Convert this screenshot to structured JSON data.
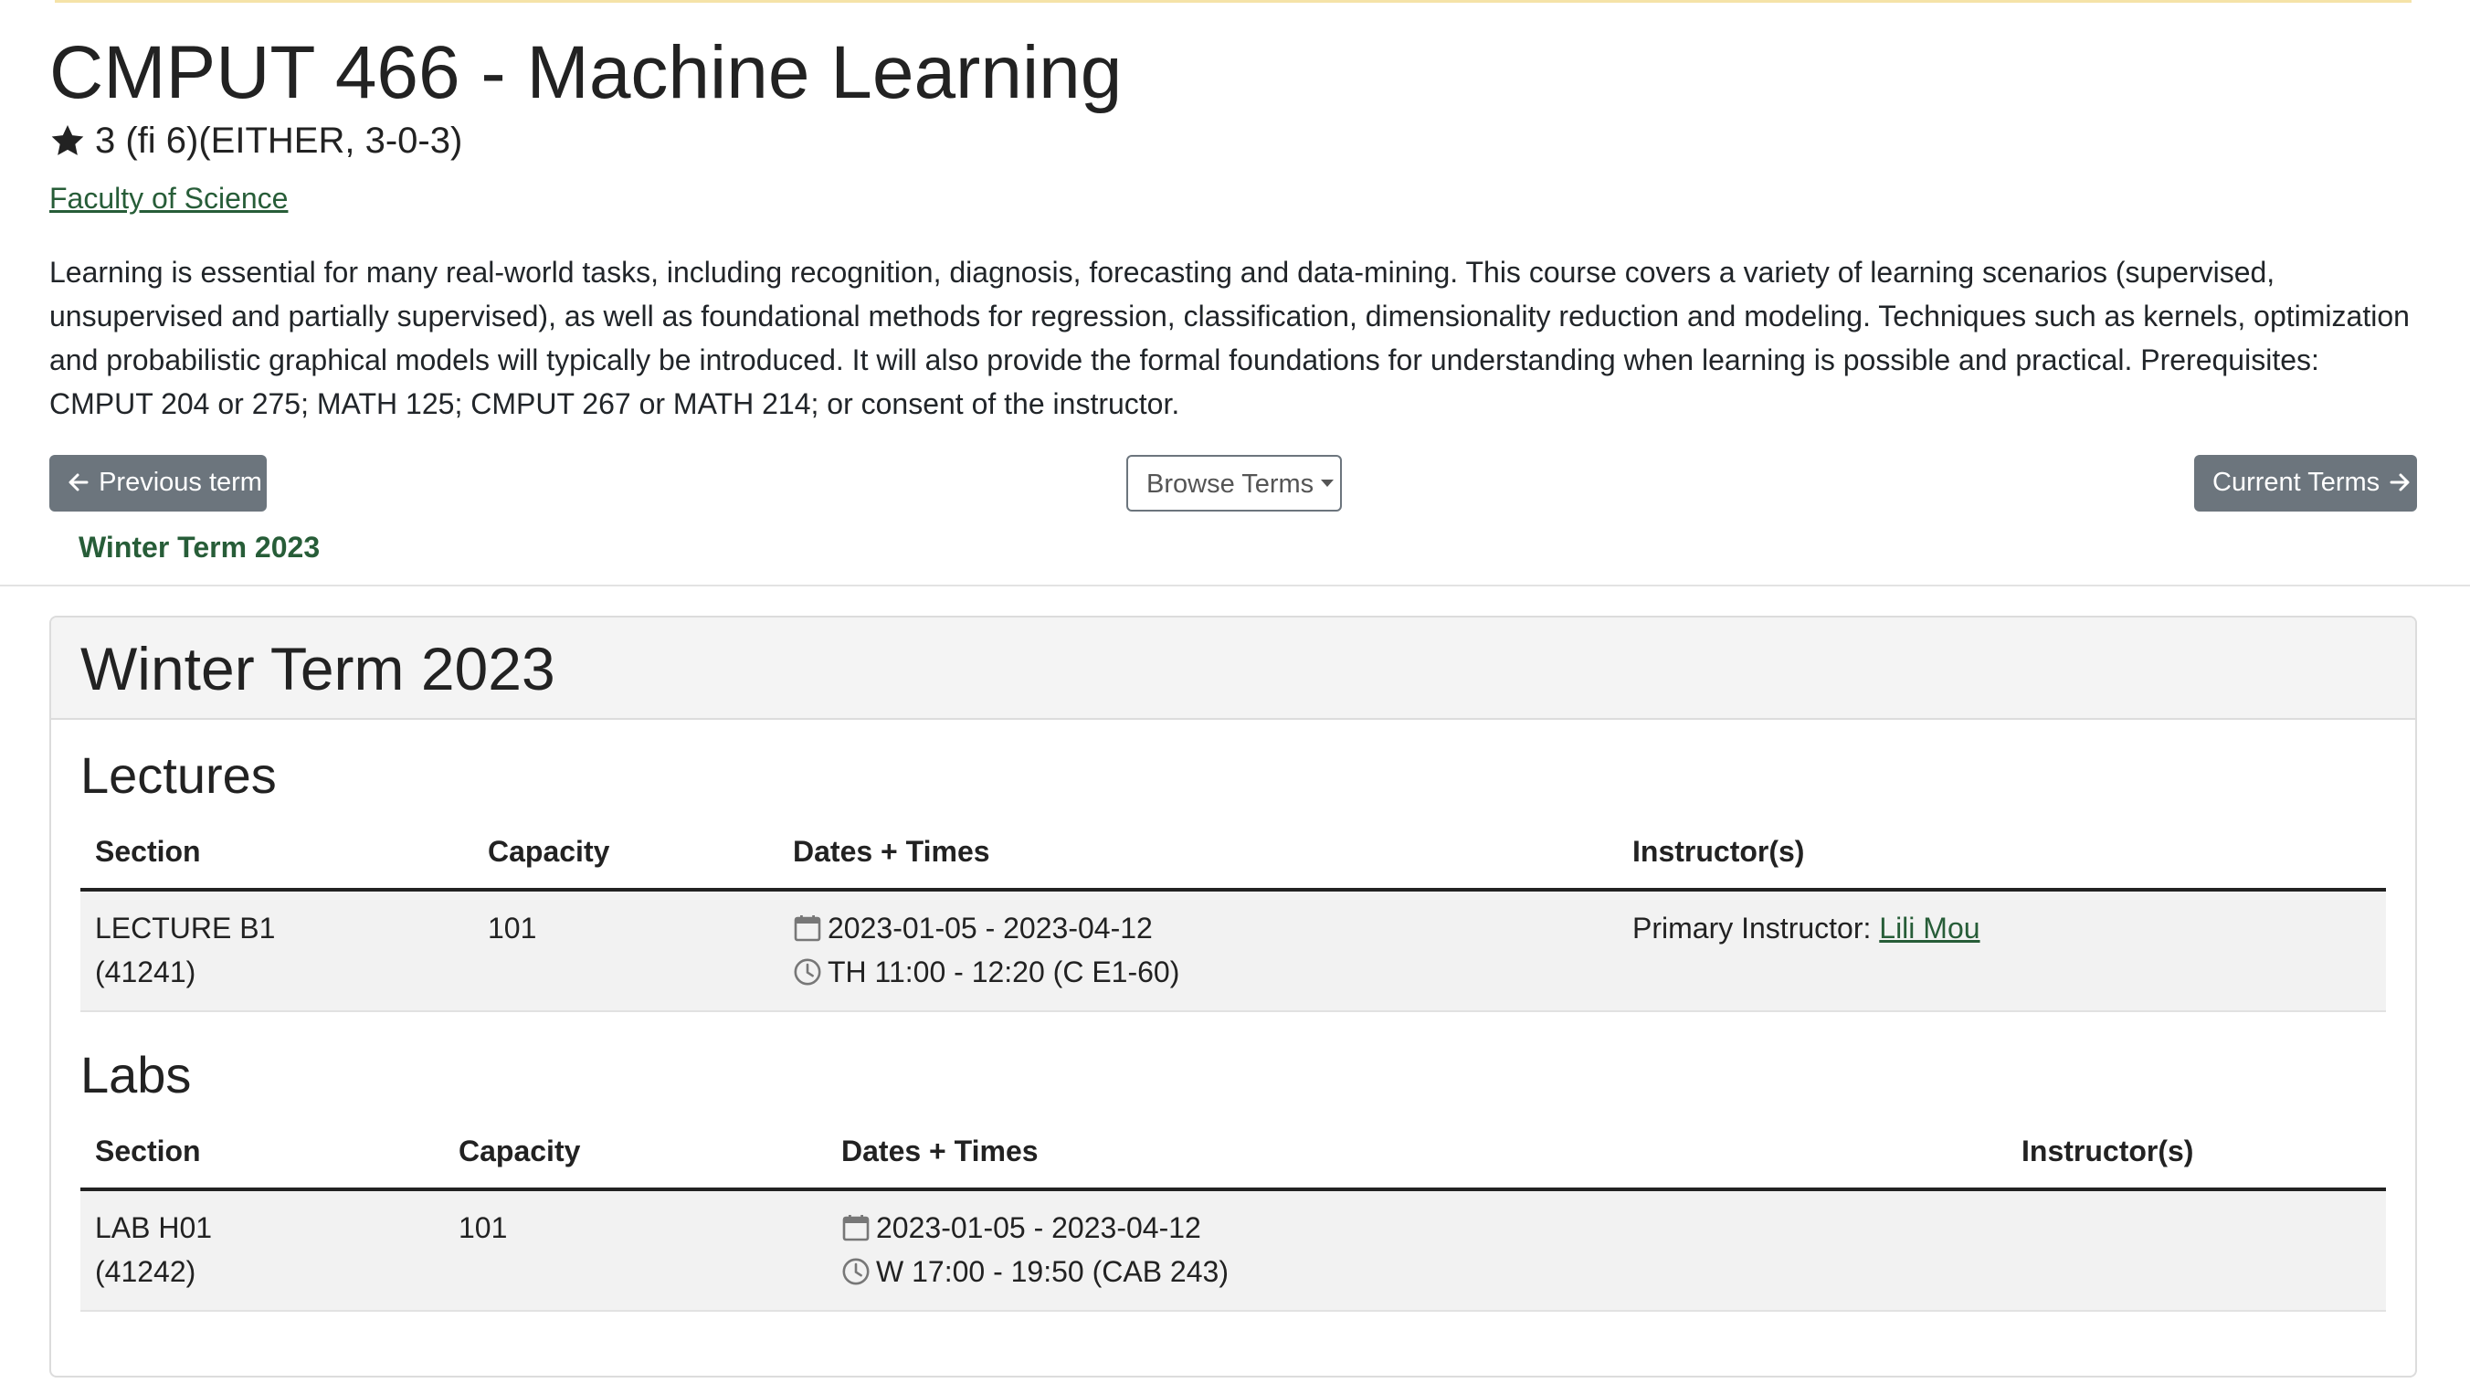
{
  "course": {
    "title": "CMPUT 466 - Machine Learning",
    "credits": "3 (fi 6)(EITHER, 3-0-3)",
    "faculty": "Faculty of Science",
    "description": "Learning is essential for many real-world tasks, including recognition, diagnosis, forecasting and data-mining. This course covers a variety of learning scenarios (supervised, unsupervised and partially supervised), as well as foundational methods for regression, classification, dimensionality reduction and modeling. Techniques such as kernels, optimization and probabilistic graphical models will typically be introduced. It will also provide the formal foundations for understanding when learning is possible and practical. Prerequisites: CMPUT 204 or 275; MATH 125; CMPUT 267 or MATH 214; or consent of the instructor."
  },
  "nav": {
    "previous_label": "Previous term",
    "browse_label": "Browse Terms",
    "current_label": "Current Terms",
    "term_tab": "Winter Term 2023"
  },
  "term": {
    "title": "Winter Term 2023",
    "lectures": {
      "heading": "Lectures",
      "headers": [
        "Section",
        "Capacity",
        "Dates + Times",
        "Instructor(s)"
      ],
      "rows": [
        {
          "section": "LECTURE B1",
          "section_id": "(41241)",
          "capacity": "101",
          "dates": "2023-01-05 - 2023-04-12",
          "times": "TH 11:00 - 12:20 (C E1-60)",
          "instructor_prefix": "Primary Instructor:",
          "instructor_name": "Lili Mou"
        }
      ]
    },
    "labs": {
      "heading": "Labs",
      "headers": [
        "Section",
        "Capacity",
        "Dates + Times",
        "Instructor(s)"
      ],
      "rows": [
        {
          "section": "LAB H01",
          "section_id": "(41242)",
          "capacity": "101",
          "dates": "2023-01-05 - 2023-04-12",
          "times": "W 17:00 - 19:50 (CAB 243)"
        }
      ]
    }
  },
  "icons": {
    "credits": "star-icon",
    "previous": "arrow-left-icon",
    "browse": "caret-down-icon",
    "current": "arrow-right-icon",
    "dates": "calendar-icon",
    "times": "clock-icon"
  },
  "colors": {
    "link": "#275d38",
    "button": "#6c757d"
  }
}
